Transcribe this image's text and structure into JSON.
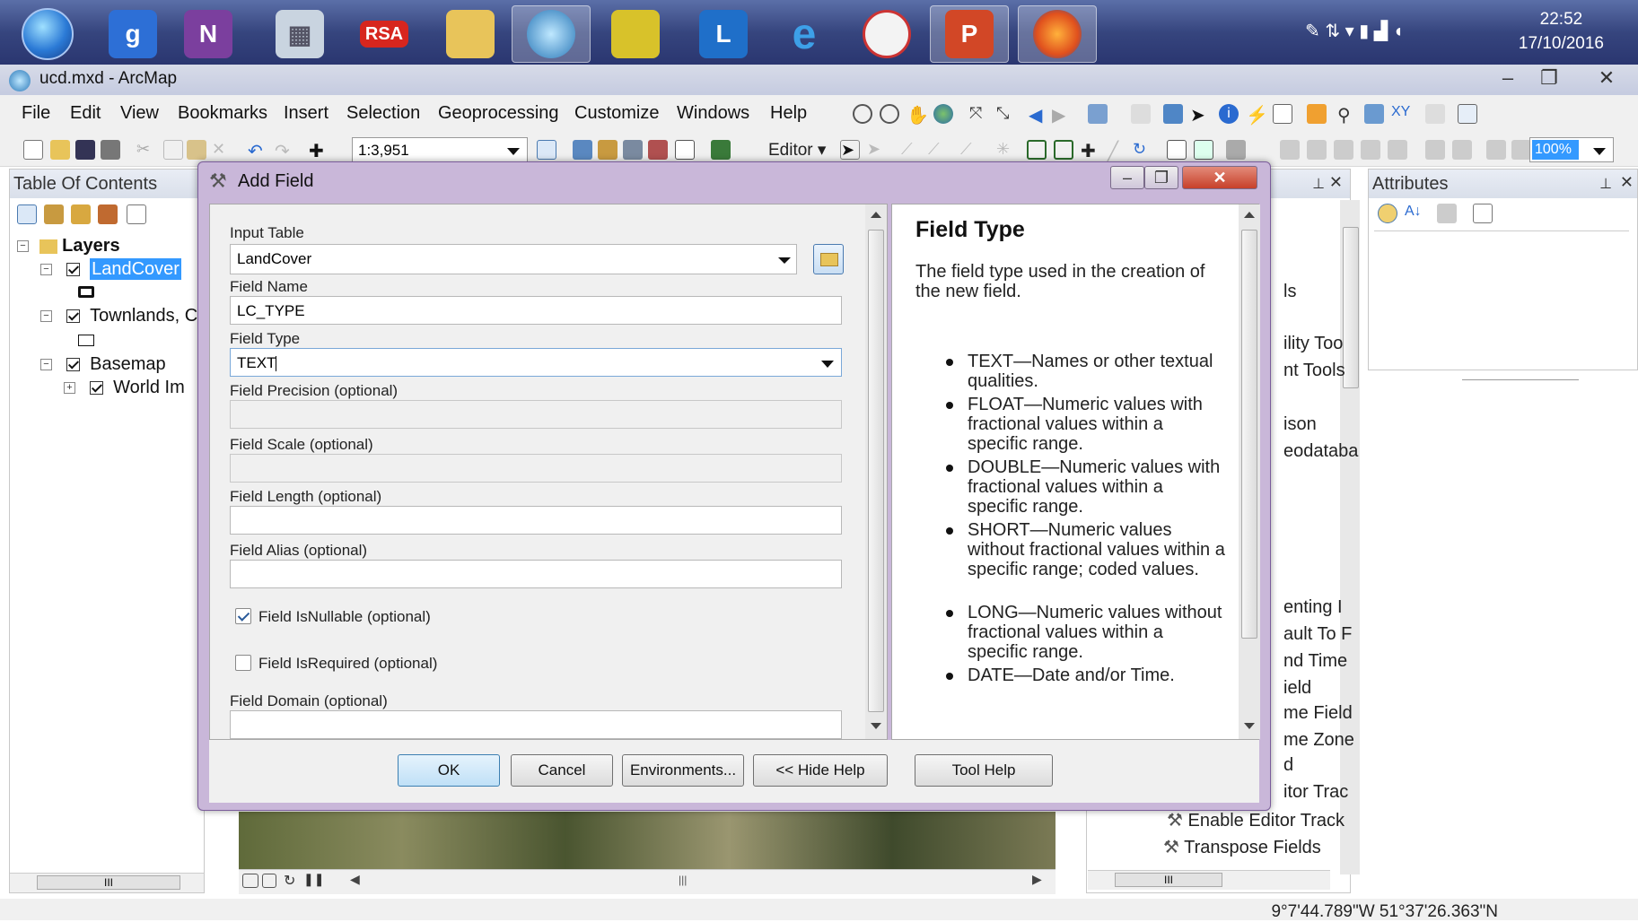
{
  "taskbar": {
    "apps": [
      "start-orb",
      "google",
      "onenote",
      "calculator",
      "rsa",
      "file-explorer",
      "magnifier",
      "lock",
      "lync",
      "internet-explorer",
      "clock-app",
      "powerpoint",
      "firefox"
    ],
    "rsa_label": "RSA",
    "clock_time": "22:52",
    "clock_date": "17/10/2016"
  },
  "window": {
    "title": "ucd.mxd - ArcMap"
  },
  "menubar": {
    "items": [
      "File",
      "Edit",
      "View",
      "Bookmarks",
      "Insert",
      "Selection",
      "Geoprocessing",
      "Customize",
      "Windows",
      "Help"
    ]
  },
  "toolbar": {
    "scale": "1:3,951",
    "editor_label": "Editor",
    "zoom_value": "100%"
  },
  "toc": {
    "title": "Table Of Contents",
    "layers_label": "Layers",
    "layer1": "LandCover",
    "layer2": "Townlands, C",
    "basemap": "Basemap",
    "world_imagery": "World Im",
    "scroll_glyph": "III"
  },
  "catalog": {
    "visible_fragments": [
      "ls",
      "ility Too",
      "nt Tools",
      "ison",
      "eodataba",
      "enting I",
      "ault To F",
      "nd Time",
      "ield",
      "me Field",
      "me Zone",
      "d",
      "itor Trac",
      "Enable Editor Track",
      "Transpose Fields"
    ],
    "scroll_glyph": "III"
  },
  "attributes": {
    "title": "Attributes"
  },
  "dialog": {
    "title": "Add Field",
    "input_table_label": "Input Table",
    "input_table_value": "LandCover",
    "field_name_label": "Field Name",
    "field_name_value": "LC_TYPE",
    "field_type_label": "Field Type",
    "field_type_value": "TEXT",
    "field_precision_label": "Field Precision (optional)",
    "field_scale_label": "Field Scale (optional)",
    "field_length_label": "Field Length (optional)",
    "field_alias_label": "Field Alias (optional)",
    "nullable_label": "Field IsNullable (optional)",
    "nullable_checked": true,
    "required_label": "Field IsRequired (optional)",
    "required_checked": false,
    "domain_label": "Field Domain (optional)",
    "buttons": {
      "ok": "OK",
      "cancel": "Cancel",
      "environments": "Environments...",
      "hide_help": "<< Hide Help",
      "tool_help": "Tool Help"
    }
  },
  "help": {
    "title": "Field Type",
    "intro": "The field type used in the creation of the new field.",
    "items": [
      "TEXT—Names or other textual qualities.",
      "FLOAT—Numeric values with fractional values within a specific range.",
      "DOUBLE—Numeric values with fractional values within a specific range.",
      "SHORT—Numeric values without fractional values within a specific range; coded values.",
      "LONG—Numeric values without fractional values within a specific range.",
      "DATE—Date and/or Time."
    ]
  },
  "status": {
    "coordinates": "9°7'44.789\"W  51°37'26.363\"N"
  },
  "colors": {
    "taskbar": "#36457e",
    "dialog_frame": "#c9b7d9",
    "selection": "#3399ff"
  }
}
